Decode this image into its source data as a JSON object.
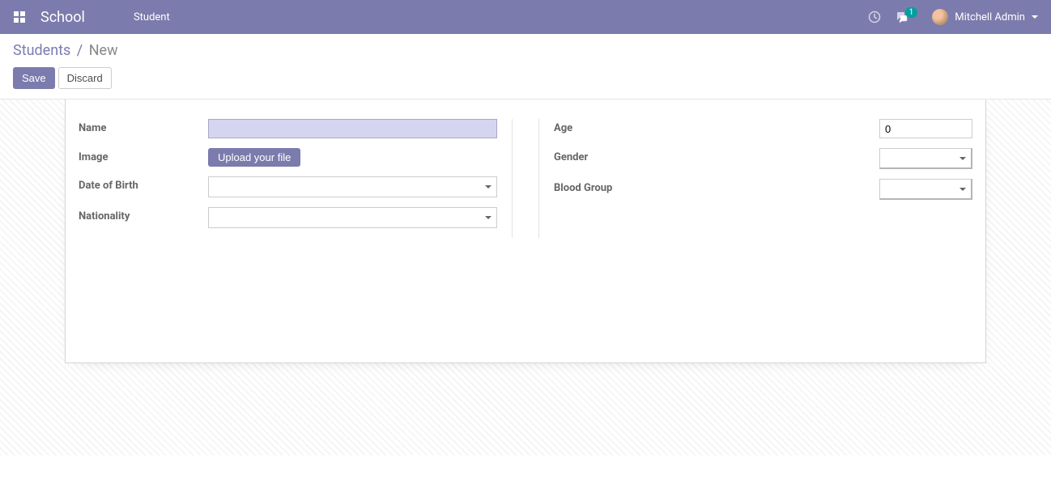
{
  "navbar": {
    "brand": "School",
    "menu_student": "Student",
    "messages_badge": "1",
    "username": "Mitchell Admin"
  },
  "breadcrumb": {
    "parent": "Students",
    "current": "New"
  },
  "buttons": {
    "save": "Save",
    "discard": "Discard"
  },
  "form": {
    "name_label": "Name",
    "name_value": "",
    "image_label": "Image",
    "upload_label": "Upload your file",
    "dob_label": "Date of Birth",
    "dob_value": "",
    "nationality_label": "Nationality",
    "nationality_value": "",
    "age_label": "Age",
    "age_value": "0",
    "gender_label": "Gender",
    "gender_value": "",
    "blood_label": "Blood Group",
    "blood_value": ""
  }
}
